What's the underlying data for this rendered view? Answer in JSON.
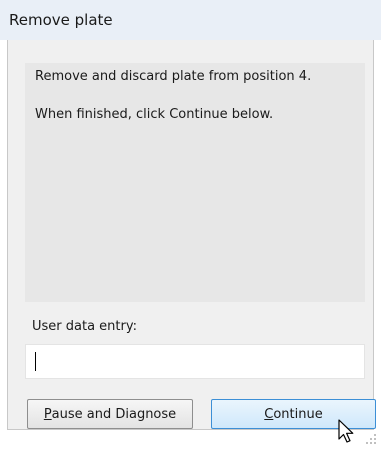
{
  "window": {
    "title": "Remove plate"
  },
  "instructions": {
    "line1": "Remove and discard plate from position 4.",
    "line2": "When finished, click Continue below."
  },
  "entry": {
    "label": "User data entry:",
    "value": ""
  },
  "buttons": {
    "pause": {
      "mnemonic": "P",
      "rest": "ause and Diagnose"
    },
    "continue": {
      "mnemonic": "C",
      "rest": "ontinue"
    }
  },
  "icons": {
    "cursor": "mouse-pointer-icon",
    "grip": "resize-grip-icon"
  }
}
